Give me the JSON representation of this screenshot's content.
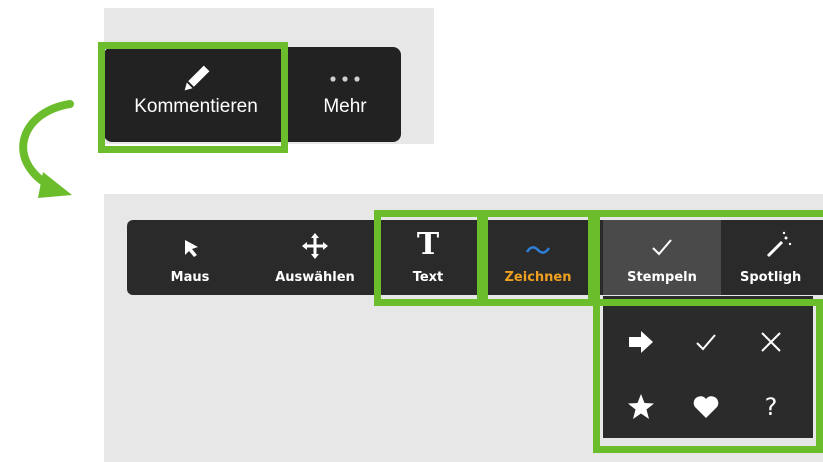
{
  "top_toolbar": {
    "items": [
      {
        "label": "Kommentieren",
        "icon": "pencil-icon"
      },
      {
        "label": "Mehr",
        "icon": "more-dots-icon"
      }
    ]
  },
  "annotation_toolbar": {
    "items": [
      {
        "label": "Maus",
        "icon": "cursor-arrow-icon"
      },
      {
        "label": "Auswählen",
        "icon": "move-arrows-icon"
      },
      {
        "label": "Text",
        "icon": "text-t-icon"
      },
      {
        "label": "Zeichnen",
        "icon": "wave-line-icon"
      },
      {
        "label": "Stempeln",
        "icon": "checkmark-icon"
      },
      {
        "label": "Spotligh",
        "icon": "magic-wand-icon"
      }
    ]
  },
  "stamp_menu": {
    "icons": [
      "arrow-right-icon",
      "checkmark-icon",
      "x-icon",
      "star-icon",
      "heart-icon",
      "question-mark-icon"
    ],
    "question_glyph": "?"
  },
  "colors": {
    "highlight": "#6bbd2c",
    "curved_arrow": "#6bbd2c",
    "zeichnen_label": "#f0a020",
    "zeichnen_icon": "#2e7fd8",
    "toolbar_bg": "#2a2a2a"
  }
}
